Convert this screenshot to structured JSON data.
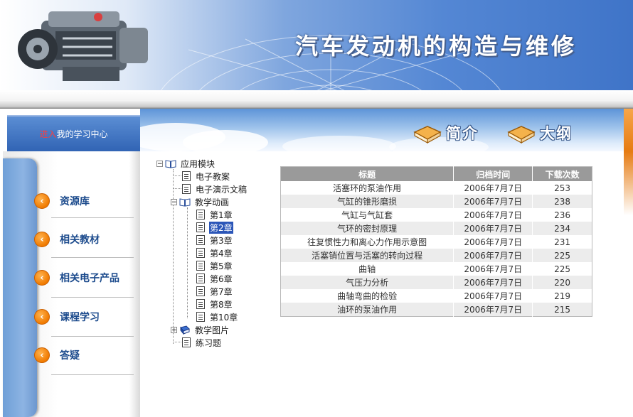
{
  "banner": {
    "title": "汽车发动机的构造与维修"
  },
  "nav": {
    "enter_prefix": "进入",
    "enter_rest": "我的学习中心",
    "buttons": [
      {
        "label": "简介"
      },
      {
        "label": "大纲"
      }
    ]
  },
  "sidebar": {
    "items": [
      {
        "label": "资源库"
      },
      {
        "label": "相关教材"
      },
      {
        "label": "相关电子产品"
      },
      {
        "label": "课程学习"
      },
      {
        "label": "答疑"
      }
    ]
  },
  "tree": {
    "root": "应用模块",
    "children": [
      {
        "label": "电子教案"
      },
      {
        "label": "电子演示文稿"
      },
      {
        "label": "教学动画",
        "expanded": true,
        "children": [
          "第1章",
          "第2章",
          "第3章",
          "第4章",
          "第5章",
          "第6章",
          "第7章",
          "第8章",
          "第10章"
        ],
        "selected": "第2章"
      },
      {
        "label": "教学图片",
        "expanded": false
      },
      {
        "label": "练习题"
      }
    ]
  },
  "table": {
    "headers": [
      "标题",
      "归档时间",
      "下载次数"
    ],
    "rows": [
      [
        "活塞环的泵油作用",
        "2006年7月7日",
        "253"
      ],
      [
        "气缸的锥形磨损",
        "2006年7月7日",
        "238"
      ],
      [
        "气缸与气缸套",
        "2006年7月7日",
        "236"
      ],
      [
        "气环的密封原理",
        "2006年7月7日",
        "234"
      ],
      [
        "往复惯性力和离心力作用示意图",
        "2006年7月7日",
        "231"
      ],
      [
        "活塞销位置与活塞的转向过程",
        "2006年7月7日",
        "225"
      ],
      [
        "曲轴",
        "2006年7月7日",
        "225"
      ],
      [
        "气压力分析",
        "2006年7月7日",
        "220"
      ],
      [
        "曲轴弯曲的检验",
        "2006年7月7日",
        "219"
      ],
      [
        "油环的泵油作用",
        "2006年7月7日",
        "215"
      ]
    ]
  },
  "colors": {
    "accent": "#f07a00",
    "header_blue": "#3f74c8",
    "table_header": "#9a9a9a",
    "selected": "#2b56b8"
  }
}
